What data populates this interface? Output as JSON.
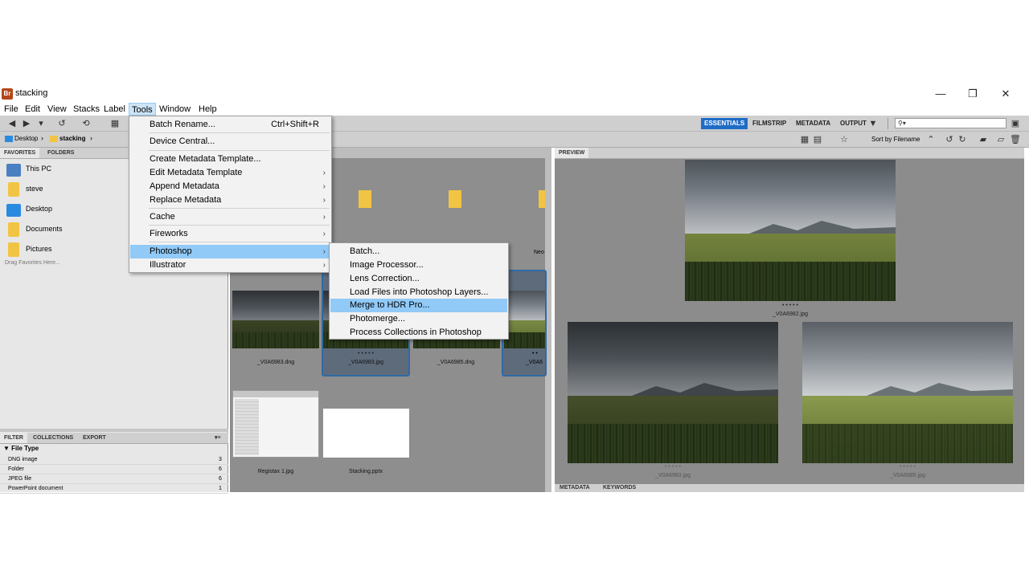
{
  "window": {
    "title": "stacking",
    "app_icon_text": "Br",
    "controls": [
      "minimize",
      "restore",
      "close"
    ]
  },
  "menubar": {
    "items": [
      "File",
      "Edit",
      "View",
      "Stacks",
      "Label",
      "Tools",
      "Window",
      "Help"
    ],
    "active": "Tools"
  },
  "workspaces": {
    "items": [
      "ESSENTIALS",
      "FILMSTRIP",
      "METADATA",
      "OUTPUT"
    ],
    "active": "ESSENTIALS",
    "output_chevron": "▼"
  },
  "search": {
    "placeholder": ""
  },
  "pathbar": {
    "crumbs": [
      "Desktop",
      "stacking"
    ],
    "sort_label": "Sort by Filename"
  },
  "left_panel": {
    "tabs": [
      "FAVORITES",
      "FOLDERS"
    ],
    "favorites": [
      {
        "label": "This PC",
        "icon": "computer-icon",
        "color": "#4a7fc1"
      },
      {
        "label": "steve",
        "icon": "folder-icon",
        "color": "#f2c443"
      },
      {
        "label": "Desktop",
        "icon": "desktop-icon",
        "color": "#2a8ae0"
      },
      {
        "label": "Documents",
        "icon": "documents-icon",
        "color": "#f2c443"
      },
      {
        "label": "Pictures",
        "icon": "pictures-icon",
        "color": "#f2c443"
      }
    ],
    "drag_hint": "Drag Favorites Here..."
  },
  "filter_panel": {
    "tabs": [
      "FILTER",
      "COLLECTIONS",
      "EXPORT"
    ],
    "section": "File Type",
    "rows": [
      {
        "label": "DNG image",
        "count": "3"
      },
      {
        "label": "Folder",
        "count": "6"
      },
      {
        "label": "JPEG file",
        "count": "6"
      },
      {
        "label": "PowerPoint document",
        "count": "1"
      }
    ]
  },
  "content": {
    "partial_label": "Neo",
    "thumbnails": [
      {
        "label": "_V0A6983.dng",
        "dots": ""
      },
      {
        "label": "_V0A6983.jpg",
        "dots": "• • • • •"
      },
      {
        "label": "_V0A6985.dng",
        "dots": ""
      },
      {
        "label": "_V0A6",
        "dots": "• •"
      },
      {
        "label": "Registax 1.jpg",
        "dots": ""
      },
      {
        "label": "Stacking.pptx",
        "dots": ""
      }
    ]
  },
  "preview": {
    "tab": "PREVIEW",
    "images": [
      {
        "label": "_V0A6982.jpg",
        "dots": "• • • • •"
      },
      {
        "label": "_V0A6983.jpg",
        "dots": "• • • • •"
      },
      {
        "label": "_V0A6985.jpg",
        "dots": "• • • • •"
      }
    ],
    "bottom_tabs": [
      "METADATA",
      "KEYWORDS"
    ]
  },
  "tools_menu": {
    "items": [
      {
        "label": "Batch Rename...",
        "shortcut": "Ctrl+Shift+R",
        "submenu": false
      },
      {
        "label": "Device Central...",
        "shortcut": "",
        "submenu": false
      },
      {
        "label": "Create Metadata Template...",
        "shortcut": "",
        "submenu": false
      },
      {
        "label": "Edit Metadata Template",
        "shortcut": "",
        "submenu": true
      },
      {
        "label": "Append Metadata",
        "shortcut": "",
        "submenu": true
      },
      {
        "label": "Replace Metadata",
        "shortcut": "",
        "submenu": true
      },
      {
        "label": "Cache",
        "shortcut": "",
        "submenu": true
      },
      {
        "label": "Fireworks",
        "shortcut": "",
        "submenu": true
      },
      {
        "label": "Photoshop",
        "shortcut": "",
        "submenu": true
      },
      {
        "label": "Illustrator",
        "shortcut": "",
        "submenu": true
      }
    ],
    "highlighted": "Photoshop"
  },
  "photoshop_submenu": {
    "items": [
      "Batch...",
      "Image Processor...",
      "Lens Correction...",
      "Load Files into Photoshop Layers...",
      "Merge to HDR Pro...",
      "Photomerge...",
      "Process Collections in Photoshop"
    ],
    "highlighted": "Merge to HDR Pro..."
  },
  "colors": {
    "accent": "#1f6cc7",
    "menu_highlight": "#91c9f7",
    "panel_bg": "#8e8e8e"
  }
}
